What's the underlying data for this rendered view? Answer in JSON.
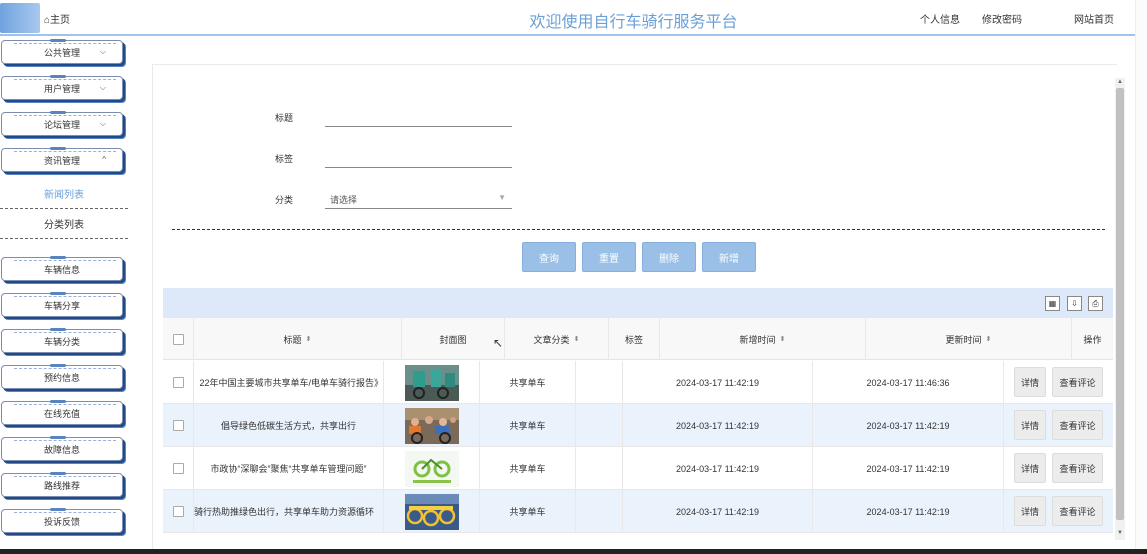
{
  "header": {
    "home_label": "主页",
    "title": "欢迎使用自行车骑行服务平台",
    "nav": [
      {
        "label": "个人信息"
      },
      {
        "label": "修改密码"
      },
      {
        "label": "网站首页"
      }
    ]
  },
  "sidebar": {
    "menus_top": [
      {
        "label": "公共管理",
        "chevron": "⌵"
      },
      {
        "label": "用户管理",
        "chevron": "⌵"
      },
      {
        "label": "论坛管理",
        "chevron": "⌵"
      },
      {
        "label": "资讯管理",
        "chevron": "^"
      }
    ],
    "submenus": [
      {
        "label": "新闻列表",
        "active": true
      },
      {
        "label": "分类列表",
        "active": false
      }
    ],
    "menus_bottom": [
      {
        "label": "车辆信息"
      },
      {
        "label": "车辆分享"
      },
      {
        "label": "车辆分类"
      },
      {
        "label": "预约信息"
      },
      {
        "label": "在线充值"
      },
      {
        "label": "故障信息"
      },
      {
        "label": "路线推荐"
      },
      {
        "label": "投诉反馈"
      }
    ]
  },
  "search_form": {
    "title_label": "标题",
    "title_value": "",
    "tag_label": "标签",
    "tag_value": "",
    "category_label": "分类",
    "category_placeholder": "请选择"
  },
  "actions": {
    "query": "查询",
    "reset": "重置",
    "delete": "删除",
    "add": "新增"
  },
  "table": {
    "columns": [
      "标题",
      "封面图",
      "文章分类",
      "标签",
      "新增时间",
      "更新时间",
      "操作"
    ],
    "rows": [
      {
        "title": "22年中国主要城市共享单车/电单车骑行报告》",
        "category": "共享单车",
        "tag": "",
        "created": "2024-03-17 11:42:19",
        "updated": "2024-03-17 11:46:36",
        "detail": "详情",
        "comments": "查看评论"
      },
      {
        "title": "倡导绿色低碳生活方式，共享出行",
        "category": "共享单车",
        "tag": "",
        "created": "2024-03-17 11:42:19",
        "updated": "2024-03-17 11:42:19",
        "detail": "详情",
        "comments": "查看评论"
      },
      {
        "title": "市政协“深聊会”聚焦“共享单车管理问题”",
        "category": "共享单车",
        "tag": "",
        "created": "2024-03-17 11:42:19",
        "updated": "2024-03-17 11:42:19",
        "detail": "详情",
        "comments": "查看评论"
      },
      {
        "title": "骑行热助推绿色出行，共享单车助力资源循环",
        "category": "共享单车",
        "tag": "",
        "created": "2024-03-17 11:42:19",
        "updated": "2024-03-17 11:42:19",
        "detail": "详情",
        "comments": "查看评论"
      }
    ]
  },
  "colors": {
    "accent": "#6b9fd7",
    "button": "#9ac0e8",
    "toolbar": "#dde9f8",
    "row_alt": "#eaf2fb"
  }
}
